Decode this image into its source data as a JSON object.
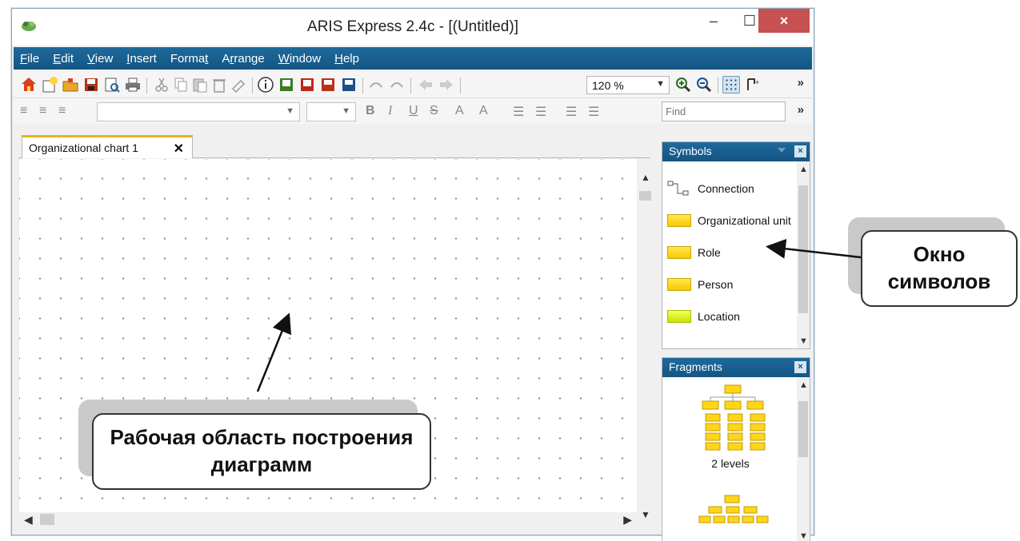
{
  "window": {
    "title": "ARIS Express 2.4c - [(Untitled)]",
    "close_symbol": "×",
    "min_symbol": "–",
    "max_symbol": "☐"
  },
  "menu": {
    "items": [
      {
        "label": "File",
        "hotkey": "F",
        "rest": "ile"
      },
      {
        "label": "Edit",
        "hotkey": "E",
        "rest": "dit"
      },
      {
        "label": "View",
        "hotkey": "V",
        "rest": "iew"
      },
      {
        "label": "Insert",
        "hotkey": "I",
        "rest": "nsert"
      },
      {
        "label": "Format",
        "pre": "Forma",
        "hotkey": "t",
        "rest": ""
      },
      {
        "label": "Arrange",
        "pre": "A",
        "hotkey": "r",
        "rest": "range"
      },
      {
        "label": "Window",
        "hotkey": "W",
        "rest": "indow"
      },
      {
        "label": "Help",
        "hotkey": "H",
        "rest": "elp"
      }
    ]
  },
  "toolbar": {
    "zoom_value": "120 %",
    "find_placeholder": "Find",
    "more": "»",
    "bold": "B",
    "italic": "I",
    "underline": "U",
    "strike": "S",
    "font_color": "A"
  },
  "editor": {
    "tab_label": "Organizational chart 1",
    "tab_close": "✕"
  },
  "symbols_panel": {
    "title": "Symbols",
    "items": [
      {
        "label": "Connection",
        "swatch": "connection"
      },
      {
        "label": "Organizational unit",
        "swatch": "yellow"
      },
      {
        "label": "Role",
        "swatch": "yellow"
      },
      {
        "label": "Person",
        "swatch": "yellow"
      },
      {
        "label": "Location",
        "swatch": "green"
      }
    ]
  },
  "fragments_panel": {
    "title": "Fragments",
    "items": [
      {
        "label": "2 levels"
      }
    ]
  },
  "callouts": {
    "workspace": "Рабочая область построения диаграмм",
    "symbols_window": "Окно символов"
  },
  "colors": {
    "accent_blue": "#145583",
    "tab_highlight": "#e8b41d",
    "symbol_yellow": "#f7c800",
    "symbol_green": "#c8e400",
    "close_red": "#c75050"
  }
}
